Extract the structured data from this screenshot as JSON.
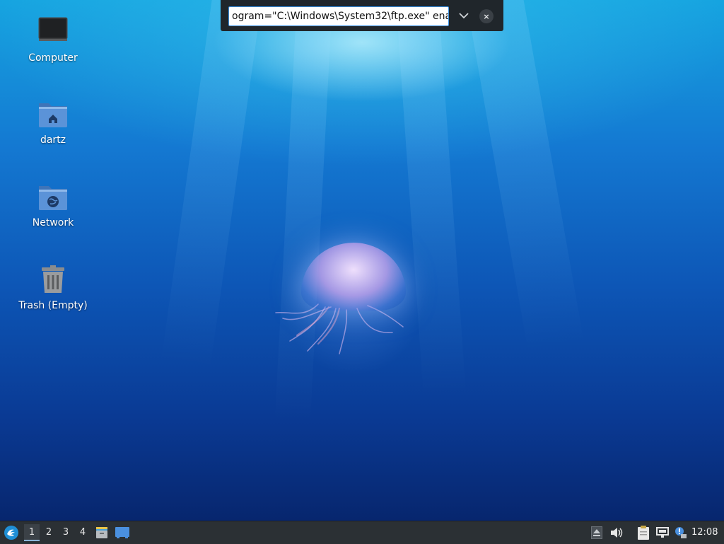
{
  "desktop": {
    "icons": [
      {
        "label": "Computer",
        "icon": "monitor-icon"
      },
      {
        "label": "dartz",
        "icon": "home-folder-icon"
      },
      {
        "label": "Network",
        "icon": "network-folder-icon"
      },
      {
        "label": "Trash (Empty)",
        "icon": "trash-icon"
      }
    ]
  },
  "runbar": {
    "value": "ogram=\"C:\\Windows\\System32\\ftp.exe\" ena",
    "dropdown_icon": "chevron-down-icon",
    "close_label": "×"
  },
  "taskbar": {
    "start_icon": "lubuntu-logo-icon",
    "workspaces": [
      "1",
      "2",
      "3",
      "4"
    ],
    "active_workspace": "1",
    "launchers": [
      "file-manager-icon",
      "show-desktop-icon"
    ],
    "tray": [
      "eject-icon",
      "volume-icon",
      "clipboard-icon",
      "network-icon",
      "update-notifier-icon"
    ],
    "clock": "12:08"
  },
  "colors": {
    "taskbar_bg": "#2b3034",
    "runbar_bg": "#20262b",
    "input_border": "#3a90e0",
    "folder_blue": "#4a86d0"
  }
}
